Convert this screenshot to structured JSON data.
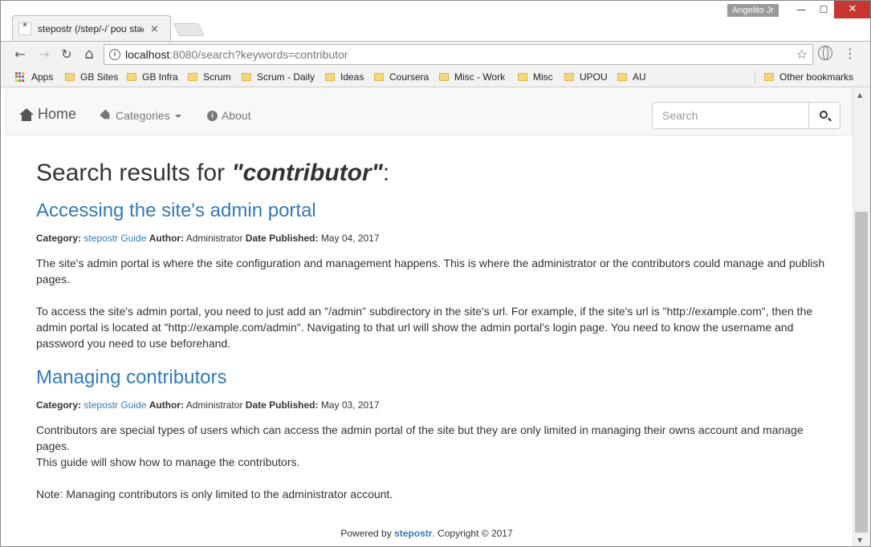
{
  "browser": {
    "tab_title": "stepostr (/step/-/ˈpoʊ stə/)",
    "tab_close": "×",
    "profile_name": "Angelito Jr",
    "window_controls": {
      "minimize": "—",
      "maximize": "☐",
      "close": "✕"
    },
    "nav": {
      "back": "←",
      "forward": "→",
      "reload": "↻",
      "home": "⌂"
    },
    "url_host": "localhost",
    "url_path": ":8080/search?keywords=contributor",
    "bookmark_star": "☆",
    "menu": "⋮",
    "bookmarks": [
      "Apps",
      "GB Sites",
      "GB Infra",
      "Scrum",
      "Scrum - Daily",
      "Ideas",
      "Coursera",
      "Misc - Work",
      "Misc",
      "UPOU",
      "AU"
    ],
    "other_bookmarks": "Other bookmarks"
  },
  "navbar": {
    "brand": "Home",
    "categories": "Categories",
    "about": "About",
    "search_placeholder": "Search"
  },
  "search": {
    "heading_prefix": "Search results for ",
    "keyword": "\"contributor\"",
    "heading_suffix": ":"
  },
  "labels": {
    "category": "Category:",
    "author": "Author:",
    "date": "Date Published:"
  },
  "results": [
    {
      "title": "Accessing the site's admin portal",
      "category": "stepostr Guide",
      "author": "Administrator",
      "date": "May 04, 2017",
      "p1": "The site's admin portal is where the site configuration and management happens. This is where the administrator or the contributors could manage and publish pages.",
      "p2": "To access the site's admin portal, you need to just add an \"/admin\" subdirectory in the site's url. For example, if the site's url is \"http://example.com\", then the admin portal is located at \"http://example.com/admin\". Navigating to that url will show the admin portal's login page. You need to know the username and password you need to use beforehand."
    },
    {
      "title": "Managing contributors",
      "category": "stepostr Guide",
      "author": "Administrator",
      "date": "May 03, 2017",
      "p1": "Contributors are special types of users which can access the admin portal of the site but they are only limited in managing their owns account and manage pages.",
      "p1b": "This guide will show how to manage the contributors.",
      "p2": "Note: Managing contributors is only limited to the administrator account."
    }
  ],
  "footer": {
    "prefix": "Powered by ",
    "brand": "stepostr",
    "suffix": ". Copyright © 2017"
  }
}
